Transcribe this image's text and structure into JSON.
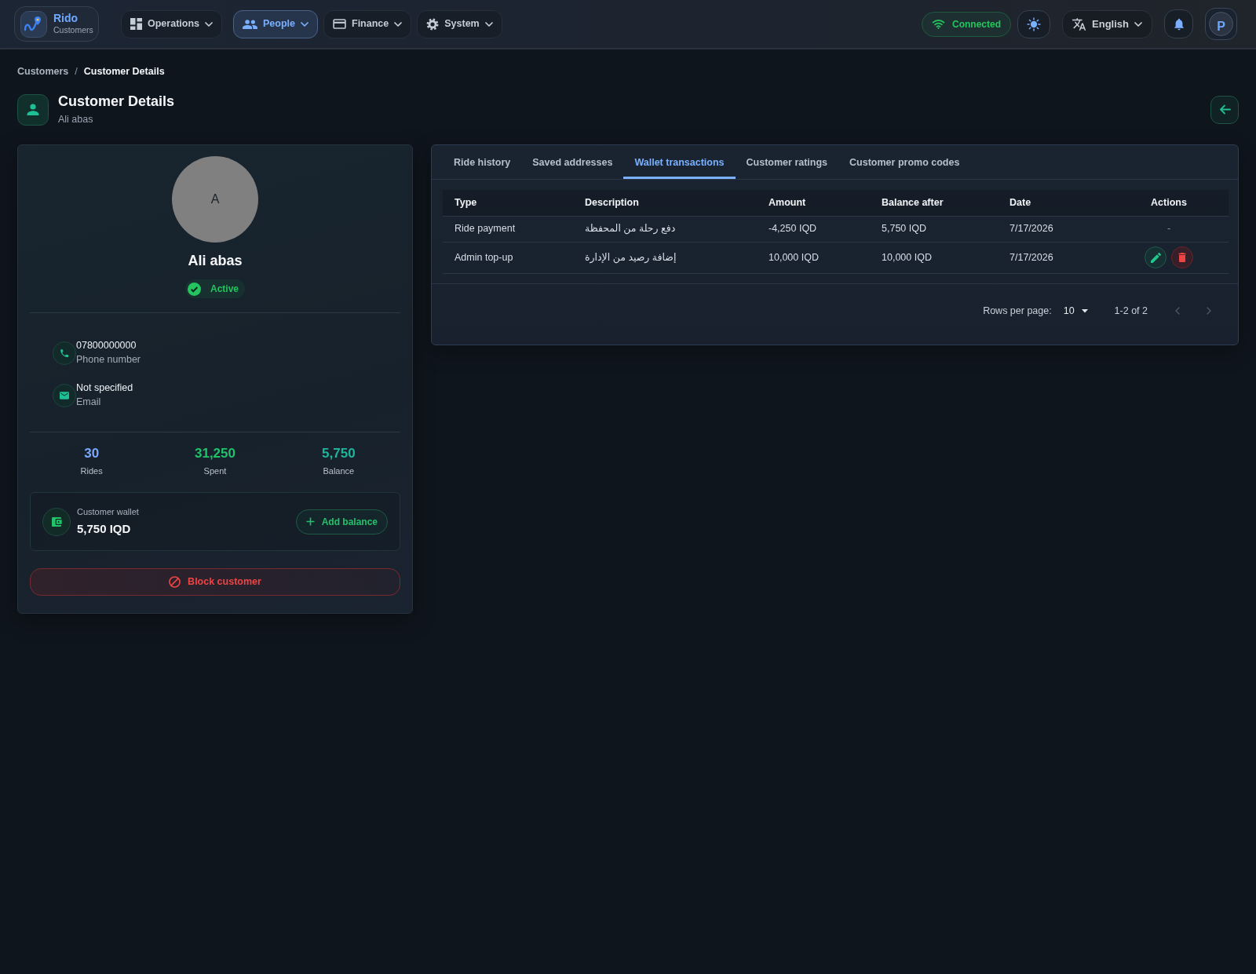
{
  "app": {
    "name": "Rido",
    "section": "Customers"
  },
  "nav": [
    {
      "label": "Operations",
      "selected": false
    },
    {
      "label": "People",
      "selected": true
    },
    {
      "label": "Finance",
      "selected": false
    },
    {
      "label": "System",
      "selected": false
    }
  ],
  "connection": {
    "label": "Connected",
    "online": true
  },
  "language": {
    "label": "English"
  },
  "user": {
    "initial": "P"
  },
  "breadcrumb": {
    "separator": "/",
    "items": [
      {
        "label": "Customers",
        "current": false
      },
      {
        "label": "Customer Details",
        "current": true
      }
    ]
  },
  "page": {
    "title": "Customer Details",
    "subtitle": "Ali abas"
  },
  "profile": {
    "initial": "A",
    "name": "Ali abas",
    "status": {
      "label": "Active",
      "active": true
    },
    "contacts": [
      {
        "value": "07800000000",
        "label": "Phone number"
      },
      {
        "value": "Not specified",
        "label": "Email"
      }
    ],
    "stats": [
      {
        "value": "30",
        "label": "Rides",
        "color": "#7aa7ff"
      },
      {
        "value": "31,250",
        "label": "Spent",
        "color": "#22c16a"
      },
      {
        "value": "5,750",
        "label": "Balance",
        "color": "#1fb59a"
      }
    ],
    "wallet": {
      "label": "Customer wallet",
      "amount": "5,750 IQD",
      "action": "Add balance"
    },
    "block_action": "Block customer"
  },
  "tabs": [
    {
      "label": "Ride history",
      "selected": false
    },
    {
      "label": "Saved addresses",
      "selected": false
    },
    {
      "label": "Wallet transactions",
      "selected": true
    },
    {
      "label": "Customer ratings",
      "selected": false
    },
    {
      "label": "Customer promo codes",
      "selected": false
    }
  ],
  "table": {
    "columns": [
      "Type",
      "Description",
      "Amount",
      "Balance after",
      "Date",
      "Actions"
    ],
    "rows": [
      {
        "type": "Ride payment",
        "description": "دفع رحلة من المحفظة",
        "amount": "-4,250 IQD",
        "balance_after": "5,750 IQD",
        "date": "7/17/2026",
        "actions": "-",
        "editable": false
      },
      {
        "type": "Admin top-up",
        "description": "إضافة رصيد من الإدارة",
        "amount": "10,000 IQD",
        "balance_after": "10,000 IQD",
        "date": "7/17/2026",
        "editable": true
      }
    ]
  },
  "pagination": {
    "rows_per_page_label": "Rows per page:",
    "rows_per_page": "10",
    "range": "1-2 of 2",
    "prev_disabled": true,
    "next_disabled": true
  }
}
